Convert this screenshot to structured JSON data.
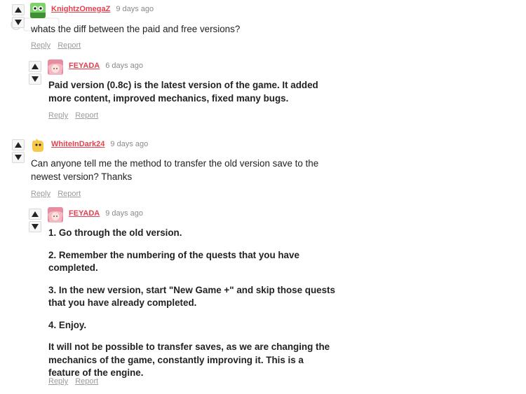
{
  "comments": [
    {
      "username": "KnightzOmegaZ",
      "date": "9 days ago",
      "paragraphs": [
        "whats the diff between the paid and free versions?"
      ],
      "reply_label": "Reply",
      "report_label": "Report"
    },
    {
      "username": "FEYADA",
      "date": "6 days ago",
      "paragraphs": [
        "Paid version (0.8c) is the latest version of the game. It added more content, improved mechanics, fixed many bugs."
      ],
      "reply_label": "Reply",
      "report_label": "Report"
    },
    {
      "username": "WhiteInDark24",
      "date": "9 days ago",
      "paragraphs": [
        "Can anyone tell me the method to transfer the old version save to the newest version? Thanks"
      ],
      "reply_label": "Reply",
      "report_label": "Report"
    },
    {
      "username": "FEYADA",
      "date": "9 days ago",
      "paragraphs": [
        "1. Go through the old version.",
        "2. Remember the numbering of the quests that you have completed.",
        "3. In the new version, start \"New Game +\" and skip those quests that you have already completed.",
        "4. Enjoy.",
        "It will not be possible to transfer saves, as we are changing the mechanics of the game, constantly improving it. This is a feature of the engine."
      ],
      "reply_label": "Reply",
      "report_label": "Report"
    }
  ],
  "icons": {
    "upvote": "upvote-arrow-icon",
    "downvote": "downvote-arrow-icon"
  },
  "colors": {
    "username": "#e4414e",
    "meta": "#8a8a8a",
    "text": "#222222"
  }
}
